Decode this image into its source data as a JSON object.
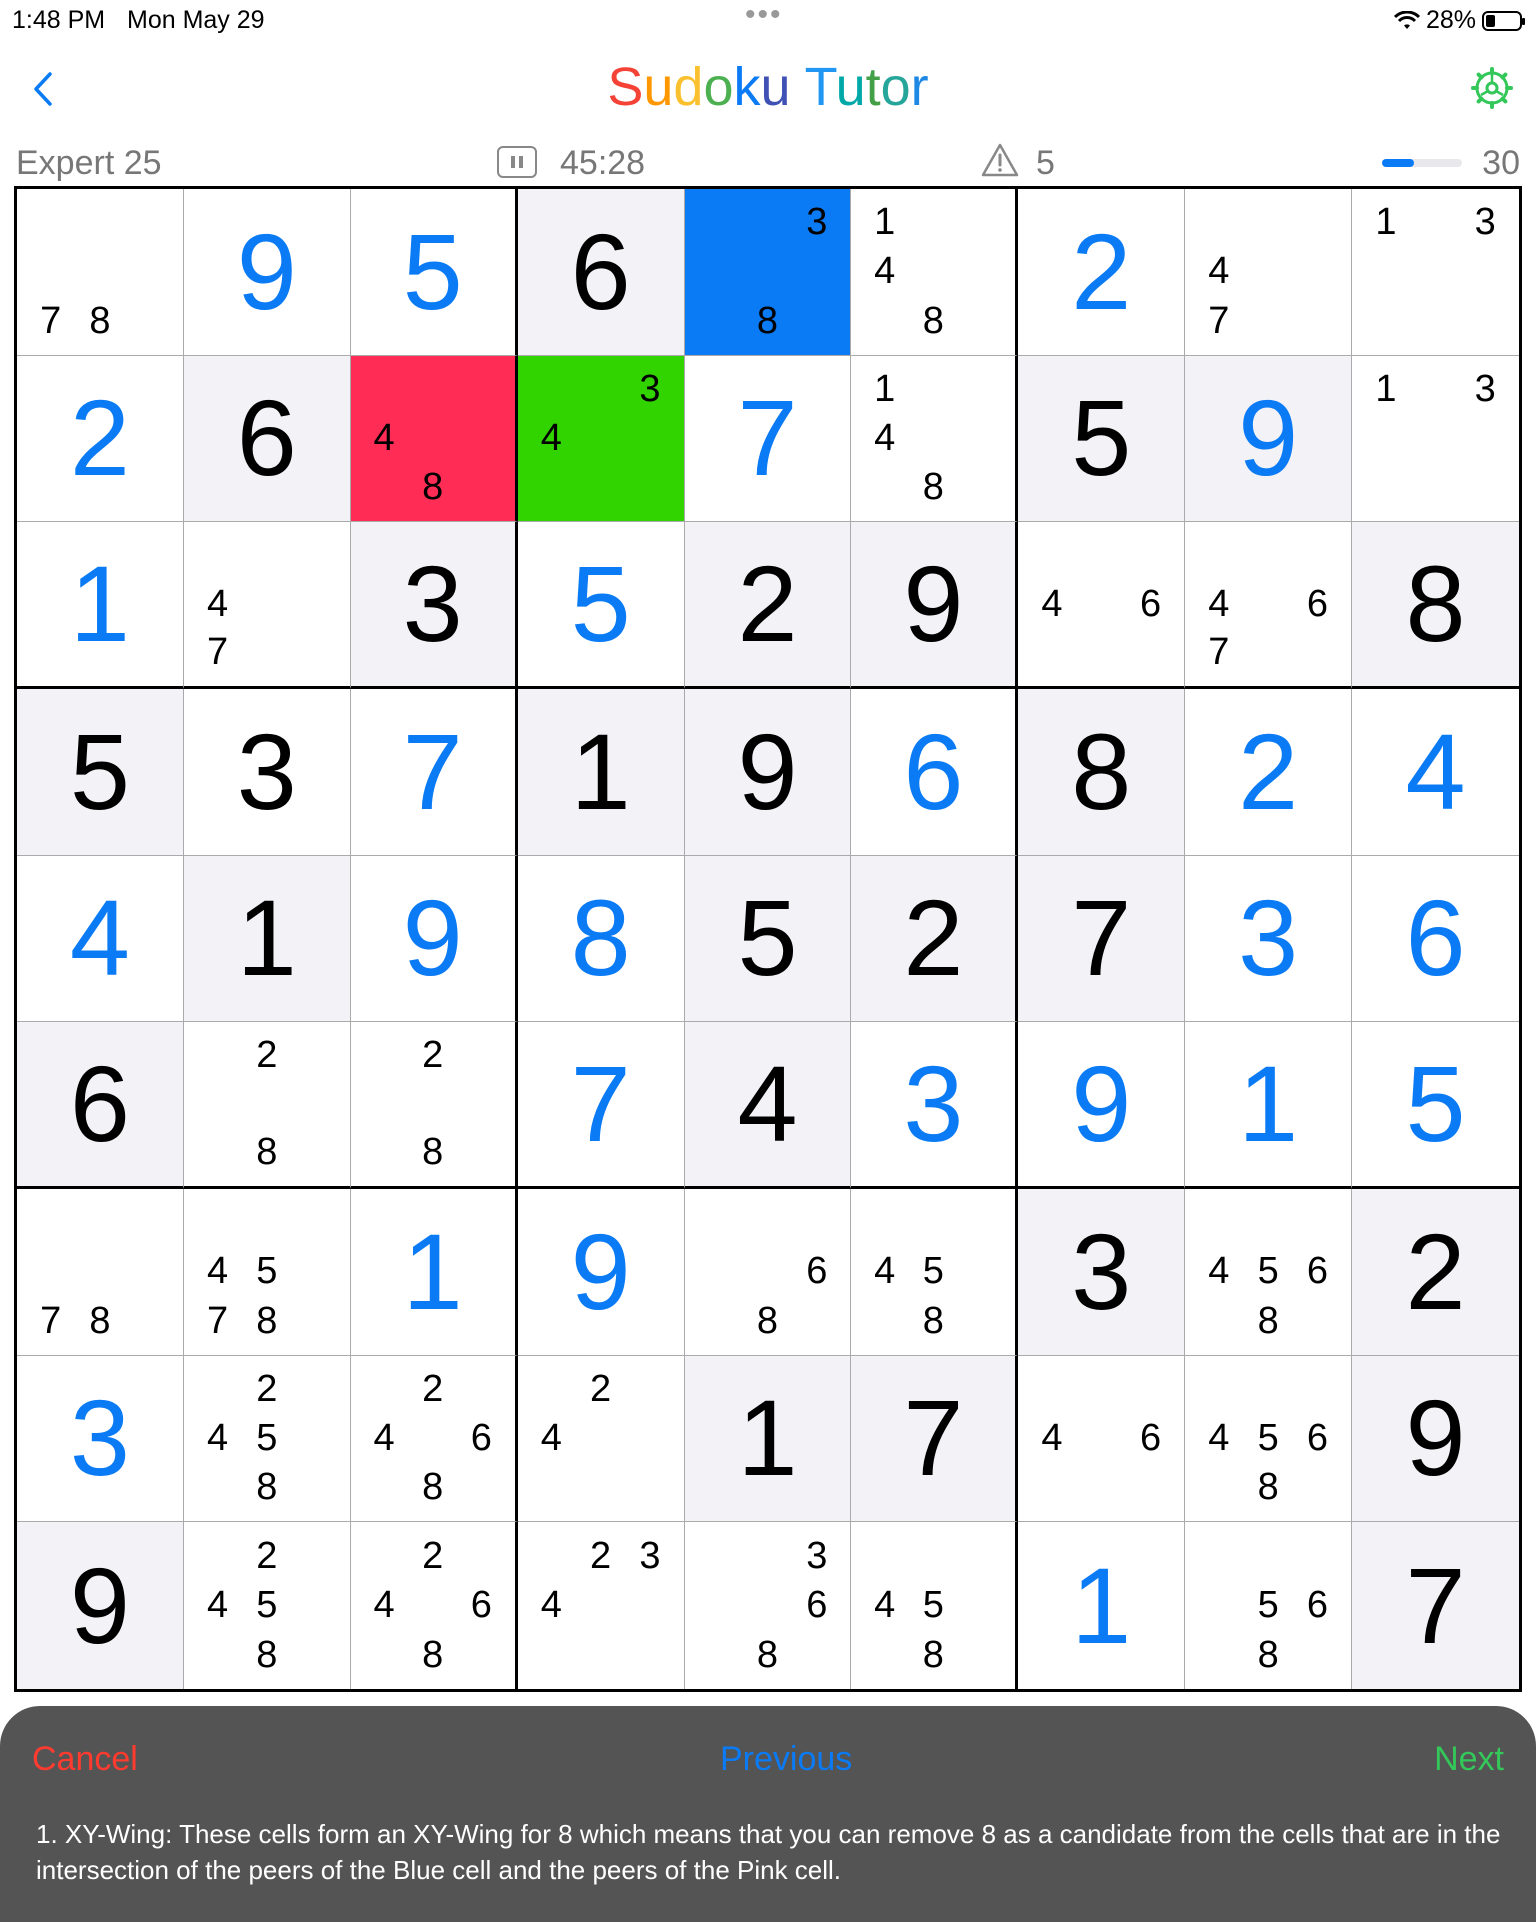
{
  "status": {
    "time": "1:48 PM",
    "date": "Mon May 29",
    "battery": "28%"
  },
  "nav": {
    "title": "Sudoku Tutor",
    "title_colors": [
      "#f44336",
      "#ff9800",
      "#fbc02d",
      "#4caf50",
      "#0a7bf5",
      "#3f51b5",
      "#2196f3",
      "#00a8a8",
      "#43a047",
      "#26a69a",
      "#1e88e5",
      "#00897b"
    ]
  },
  "info": {
    "level": "Expert 25",
    "timer": "45:28",
    "mistakes": "5",
    "score": "30",
    "progress_fraction": 0.4
  },
  "board": {
    "rows": [
      [
        {
          "c": [
            7,
            8
          ]
        },
        {
          "v": 9,
          "t": "user"
        },
        {
          "v": 5,
          "t": "user"
        },
        {
          "v": 6,
          "t": "given"
        },
        {
          "c": [
            3,
            8
          ],
          "hl": "blue"
        },
        {
          "c": [
            1,
            4,
            8
          ]
        },
        {
          "v": 2,
          "t": "user"
        },
        {
          "c": [
            4,
            7
          ]
        },
        {
          "c": [
            1,
            3
          ]
        }
      ],
      [
        {
          "v": 2,
          "t": "user"
        },
        {
          "v": 6,
          "t": "given"
        },
        {
          "c": [
            4,
            8
          ],
          "hl": "pink"
        },
        {
          "c": [
            3,
            4
          ],
          "hl": "green"
        },
        {
          "v": 7,
          "t": "user"
        },
        {
          "c": [
            1,
            4,
            8
          ]
        },
        {
          "v": 5,
          "t": "given"
        },
        {
          "v": 9,
          "t": "user"
        },
        {
          "c": [
            1,
            3
          ]
        }
      ],
      [
        {
          "v": 1,
          "t": "user"
        },
        {
          "c": [
            4,
            7
          ]
        },
        {
          "v": 3,
          "t": "given"
        },
        {
          "v": 5,
          "t": "user"
        },
        {
          "v": 2,
          "t": "given"
        },
        {
          "v": 9,
          "t": "given"
        },
        {
          "c": [
            4,
            6
          ]
        },
        {
          "c": [
            4,
            6,
            7
          ]
        },
        {
          "v": 8,
          "t": "given"
        }
      ],
      [
        {
          "v": 5,
          "t": "given"
        },
        {
          "v": 3,
          "t": "given"
        },
        {
          "v": 7,
          "t": "user"
        },
        {
          "v": 1,
          "t": "given"
        },
        {
          "v": 9,
          "t": "given"
        },
        {
          "v": 6,
          "t": "user"
        },
        {
          "v": 8,
          "t": "given"
        },
        {
          "v": 2,
          "t": "user"
        },
        {
          "v": 4,
          "t": "user"
        }
      ],
      [
        {
          "v": 4,
          "t": "user"
        },
        {
          "v": 1,
          "t": "given"
        },
        {
          "v": 9,
          "t": "user"
        },
        {
          "v": 8,
          "t": "user"
        },
        {
          "v": 5,
          "t": "given"
        },
        {
          "v": 2,
          "t": "given"
        },
        {
          "v": 7,
          "t": "given"
        },
        {
          "v": 3,
          "t": "user"
        },
        {
          "v": 6,
          "t": "user"
        }
      ],
      [
        {
          "v": 6,
          "t": "given"
        },
        {
          "c": [
            2,
            8
          ]
        },
        {
          "c": [
            2,
            8
          ]
        },
        {
          "v": 7,
          "t": "user"
        },
        {
          "v": 4,
          "t": "given"
        },
        {
          "v": 3,
          "t": "user"
        },
        {
          "v": 9,
          "t": "user"
        },
        {
          "v": 1,
          "t": "user"
        },
        {
          "v": 5,
          "t": "user"
        }
      ],
      [
        {
          "c": [
            7,
            8
          ]
        },
        {
          "c": [
            4,
            5,
            7,
            8
          ]
        },
        {
          "v": 1,
          "t": "user"
        },
        {
          "v": 9,
          "t": "user"
        },
        {
          "c": [
            6,
            8
          ]
        },
        {
          "c": [
            4,
            5,
            8
          ]
        },
        {
          "v": 3,
          "t": "given"
        },
        {
          "c": [
            4,
            5,
            6,
            8
          ]
        },
        {
          "v": 2,
          "t": "given"
        }
      ],
      [
        {
          "v": 3,
          "t": "user"
        },
        {
          "c": [
            2,
            4,
            5,
            8
          ]
        },
        {
          "c": [
            2,
            4,
            6,
            8
          ]
        },
        {
          "c": [
            2,
            4
          ]
        },
        {
          "v": 1,
          "t": "given"
        },
        {
          "v": 7,
          "t": "given"
        },
        {
          "c": [
            4,
            6
          ]
        },
        {
          "c": [
            4,
            5,
            6,
            8
          ]
        },
        {
          "v": 9,
          "t": "given"
        }
      ],
      [
        {
          "v": 9,
          "t": "given"
        },
        {
          "c": [
            2,
            4,
            5,
            8
          ]
        },
        {
          "c": [
            2,
            4,
            6,
            8
          ]
        },
        {
          "c": [
            2,
            3,
            4
          ]
        },
        {
          "c": [
            3,
            6,
            8
          ]
        },
        {
          "c": [
            4,
            5,
            8
          ]
        },
        {
          "v": 1,
          "t": "user"
        },
        {
          "c": [
            5,
            6,
            8
          ]
        },
        {
          "v": 7,
          "t": "given"
        }
      ]
    ],
    "shaded": [
      [
        0,
        3
      ],
      [
        1,
        1
      ],
      [
        1,
        2
      ],
      [
        1,
        6
      ],
      [
        1,
        7
      ],
      [
        2,
        2
      ],
      [
        2,
        4
      ],
      [
        2,
        5
      ],
      [
        2,
        8
      ],
      [
        3,
        0
      ],
      [
        3,
        3
      ],
      [
        3,
        4
      ],
      [
        3,
        6
      ],
      [
        4,
        1
      ],
      [
        4,
        4
      ],
      [
        4,
        5
      ],
      [
        4,
        6
      ],
      [
        5,
        0
      ],
      [
        5,
        4
      ],
      [
        6,
        6
      ],
      [
        6,
        8
      ],
      [
        7,
        4
      ],
      [
        7,
        5
      ],
      [
        7,
        8
      ],
      [
        8,
        0
      ],
      [
        8,
        8
      ]
    ],
    "colors": {
      "blue": "#0a7bf5",
      "pink": "#ff2d55",
      "green": "#32d400"
    }
  },
  "tutor": {
    "cancel_label": "Cancel",
    "previous_label": "Previous",
    "next_label": "Next",
    "hint": "1. XY-Wing: These cells form an XY-Wing for 8 which means that you can remove 8 as a candidate from the cells that are in the intersection of the peers of the Blue cell and the peers of the Pink cell."
  }
}
